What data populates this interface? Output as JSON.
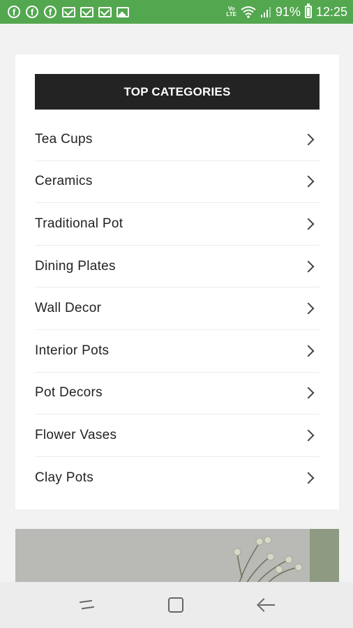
{
  "status_bar": {
    "notification_icons": [
      "facebook-icon",
      "facebook-icon",
      "facebook-icon",
      "mail-icon",
      "mail-icon",
      "mail-icon",
      "image-icon"
    ],
    "volte_top": "VoLTE",
    "volte_label": "Vo)) LTE",
    "battery_percent": "91%",
    "time": "12:25"
  },
  "categories": {
    "title": "TOP CATEGORIES",
    "items": [
      {
        "label": "Tea Cups"
      },
      {
        "label": "Ceramics"
      },
      {
        "label": "Traditional Pot"
      },
      {
        "label": "Dining Plates"
      },
      {
        "label": "Wall Decor"
      },
      {
        "label": "Interior Pots"
      },
      {
        "label": "Pot Decors"
      },
      {
        "label": "Flower Vases"
      },
      {
        "label": "Clay Pots"
      }
    ]
  },
  "colors": {
    "status_bar": "#53a74f",
    "header_bg": "#232323",
    "page_bg": "#f3f2f2"
  }
}
